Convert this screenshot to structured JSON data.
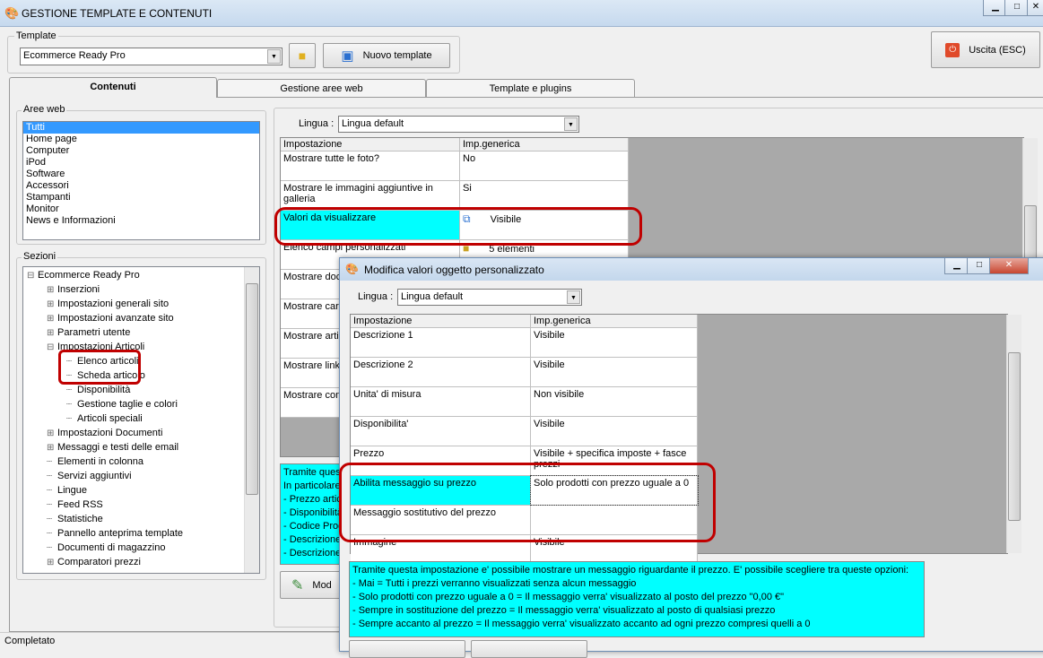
{
  "window": {
    "title": "GESTIONE TEMPLATE E CONTENUTI",
    "status": "Completato"
  },
  "template": {
    "group_label": "Template",
    "selected": "Ecommerce Ready Pro",
    "new_button": "Nuovo template",
    "exit_button": "Uscita (ESC)"
  },
  "tabs": [
    "Contenuti",
    "Gestione aree web",
    "Template e plugins"
  ],
  "aree_web": {
    "label": "Aree web",
    "items": [
      "Tutti",
      "Home page",
      "Computer",
      "iPod",
      "Software",
      "Accessori",
      "Stampanti",
      "Monitor",
      "News e Informazioni"
    ]
  },
  "sezioni": {
    "label": "Sezioni",
    "items": [
      {
        "label": "Ecommerce Ready Pro",
        "level": 0,
        "exp": "-"
      },
      {
        "label": "Inserzioni",
        "level": 1,
        "exp": "+"
      },
      {
        "label": "Impostazioni generali sito",
        "level": 1,
        "exp": "+"
      },
      {
        "label": "Impostazioni avanzate sito",
        "level": 1,
        "exp": "+"
      },
      {
        "label": "Parametri utente",
        "level": 1,
        "exp": "+"
      },
      {
        "label": "Impostazioni Articoli",
        "level": 1,
        "exp": "-"
      },
      {
        "label": "Elenco articoli",
        "level": 2,
        "exp": ""
      },
      {
        "label": "Scheda articolo",
        "level": 2,
        "exp": ""
      },
      {
        "label": "Disponibilità",
        "level": 2,
        "exp": ""
      },
      {
        "label": "Gestione taglie e colori",
        "level": 2,
        "exp": ""
      },
      {
        "label": "Articoli speciali",
        "level": 2,
        "exp": ""
      },
      {
        "label": "Impostazioni Documenti",
        "level": 1,
        "exp": "+"
      },
      {
        "label": "Messaggi e testi delle email",
        "level": 1,
        "exp": "+"
      },
      {
        "label": "Elementi in colonna",
        "level": 1,
        "exp": ""
      },
      {
        "label": "Servizi aggiuntivi",
        "level": 1,
        "exp": ""
      },
      {
        "label": "Lingue",
        "level": 1,
        "exp": ""
      },
      {
        "label": "Feed RSS",
        "level": 1,
        "exp": ""
      },
      {
        "label": "Statistiche",
        "level": 1,
        "exp": ""
      },
      {
        "label": "Pannello anteprima template",
        "level": 1,
        "exp": ""
      },
      {
        "label": "Documenti di magazzino",
        "level": 1,
        "exp": ""
      },
      {
        "label": "Comparatori prezzi",
        "level": 1,
        "exp": "+"
      }
    ]
  },
  "main": {
    "lingua_label": "Lingua :",
    "lingua_value": "Lingua default",
    "headers": [
      "Impostazione",
      "Imp.generica"
    ],
    "rows": [
      [
        "Mostrare tutte le foto?",
        "No"
      ],
      [
        "Mostrare le immagini aggiuntive in galleria",
        "Si"
      ],
      [
        "Valori da visualizzare",
        "Visibile"
      ],
      [
        "Elenco campi personalizzati",
        "5 elementi"
      ],
      [
        "Mostrare doc",
        ""
      ],
      [
        "Mostrare cara",
        ""
      ],
      [
        "Mostrare artic",
        ""
      ],
      [
        "Mostrare link",
        ""
      ],
      [
        "Mostrare con",
        ""
      ]
    ],
    "desc": [
      "Tramite ques",
      "In particolare",
      "- Prezzo artic",
      "- Disponibilità",
      "- Codice Prod",
      "- Descrizione",
      "- Descrizione"
    ],
    "modify_button": "Mod"
  },
  "dialog": {
    "title": "Modifica valori oggetto personalizzato",
    "lingua_label": "Lingua :",
    "lingua_value": "Lingua default",
    "headers": [
      "Impostazione",
      "Imp.generica"
    ],
    "rows": [
      [
        "Descrizione 1",
        "Visibile"
      ],
      [
        "Descrizione 2",
        "Visibile"
      ],
      [
        "Unita' di misura",
        "Non visibile"
      ],
      [
        "Disponibilita'",
        "Visibile"
      ],
      [
        "Prezzo",
        "Visibile + specifica imposte + fasce prezzi"
      ],
      [
        "Abilita messaggio su prezzo",
        "Solo prodotti con prezzo uguale a 0"
      ],
      [
        "Messaggio sostitutivo del prezzo",
        ""
      ],
      [
        "Immagine",
        "Visibile"
      ]
    ],
    "desc": [
      "Tramite questa impostazione e' possibile mostrare un messaggio riguardante il prezzo. E' possibile scegliere tra queste opzioni:",
      "- Mai = Tutti i prezzi verranno visualizzati senza alcun messaggio",
      "- Solo prodotti con prezzo uguale a 0 = Il messaggio verra' visualizzato al posto del prezzo \"0,00 €\"",
      "- Sempre in sostituzione del prezzo = Il messaggio verra' visualizzato al posto di qualsiasi prezzo",
      "- Sempre accanto al prezzo =  Il messaggio verra' visualizzato accanto ad ogni prezzo compresi quelli a 0"
    ]
  },
  "colors": {
    "highlight": "#00ffff",
    "annotation": "#c00000",
    "selection": "#3399ff"
  }
}
